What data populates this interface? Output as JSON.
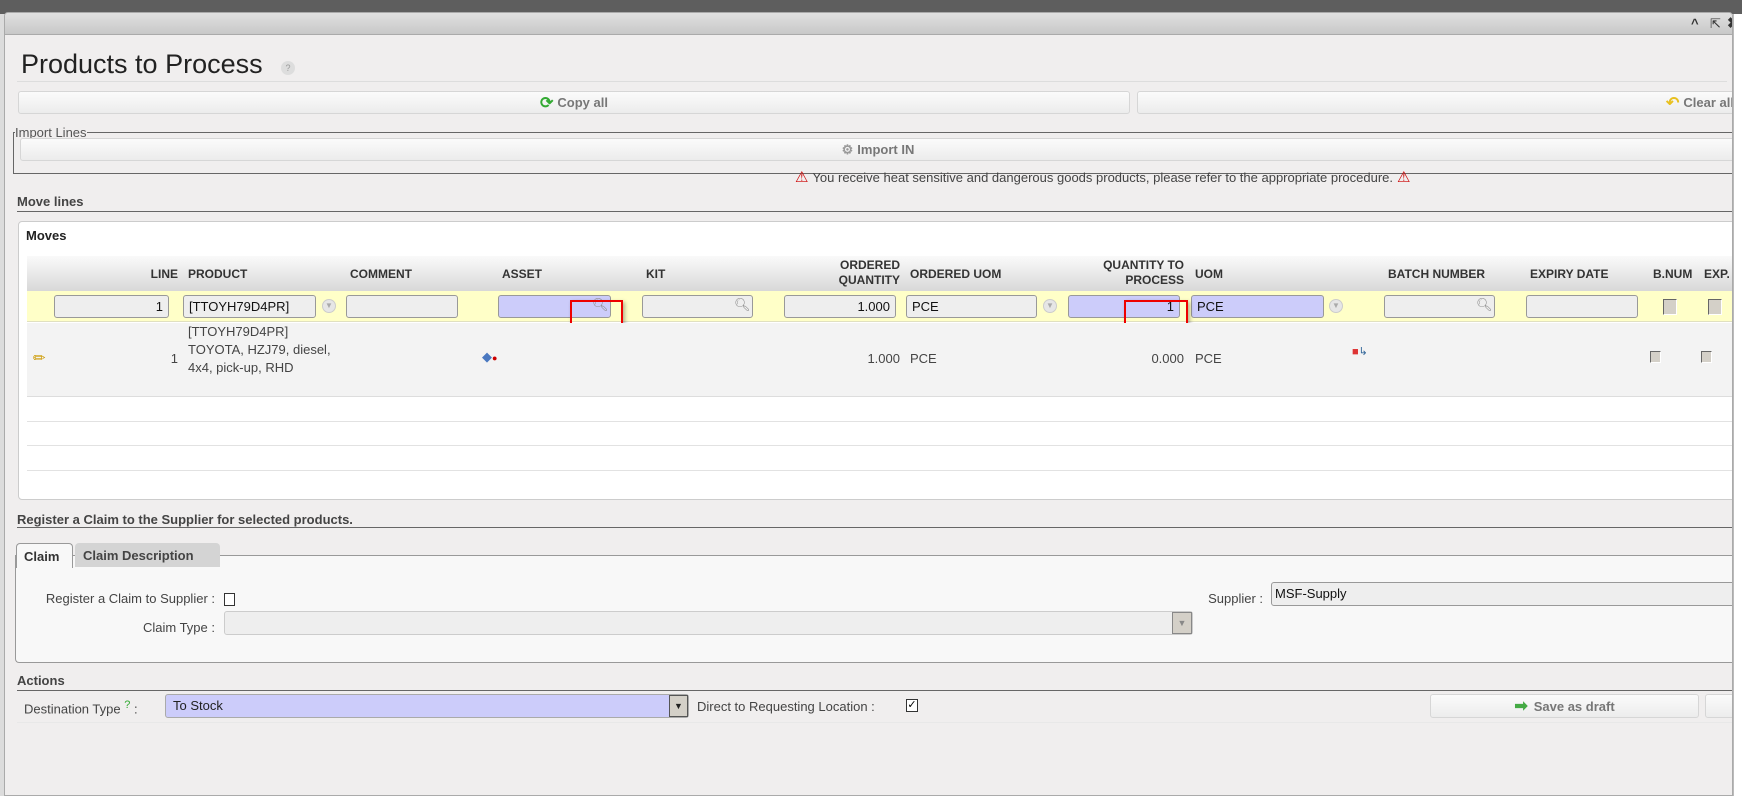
{
  "window": {
    "title": "Products to Process",
    "controls": [
      "collapse",
      "popout",
      "close"
    ]
  },
  "toolbar": {
    "copy_all": "Copy all",
    "clear_all": "Clear all"
  },
  "import": {
    "legend": "Import Lines",
    "button": "Import IN"
  },
  "warning": "You receive heat sensitive and dangerous goods products, please refer to the appropriate procedure.",
  "move_lines": {
    "heading": "Move lines",
    "box_title": "Moves",
    "columns": {
      "line": "LINE",
      "product": "PRODUCT",
      "comment": "COMMENT",
      "asset": "ASSET",
      "kit": "KIT",
      "ordered_qty_1": "ORDERED",
      "ordered_qty_2": "QUANTITY",
      "ordered_uom": "ORDERED UOM",
      "qty_process_1": "QUANTITY TO",
      "qty_process_2": "PROCESS",
      "uom": "UOM",
      "batch": "BATCH NUMBER",
      "expiry": "EXPIRY DATE",
      "bnum": "B.NUM",
      "exp": "EXP."
    },
    "edit_row": {
      "line": "1",
      "product": "[TTOYH79D4PR]",
      "comment": "",
      "asset": "",
      "kit": "",
      "ordered_qty": "1.000",
      "ordered_uom": "PCE",
      "qty_process": "1",
      "uom": "PCE",
      "batch": "",
      "expiry": ""
    },
    "rows": [
      {
        "line": "1",
        "product": "[TTOYH79D4PR] TOYOTA, HZJ79, diesel, 4x4, pick-up, RHD",
        "ordered_qty": "1.000",
        "ordered_uom": "PCE",
        "qty_process": "0.000",
        "uom": "PCE"
      }
    ]
  },
  "claim": {
    "heading": "Register a Claim to the Supplier for selected products.",
    "tabs": [
      "Claim",
      "Claim Description"
    ],
    "register_label": "Register a Claim to Supplier :",
    "claim_type_label": "Claim Type :",
    "claim_type_value": "",
    "supplier_label": "Supplier :",
    "supplier_value": "MSF-Supply"
  },
  "actions": {
    "heading": "Actions",
    "destination_label": "Destination Type",
    "help": "?",
    "colon": ":",
    "destination_value": "To Stock",
    "direct_label": "Direct to Requesting Location :",
    "direct_checked": true,
    "save_draft": "Save as draft"
  },
  "colors": {
    "accent_blue": "#ccccfa",
    "edit_row": "#ffffc8",
    "highlight": "#e00000"
  }
}
